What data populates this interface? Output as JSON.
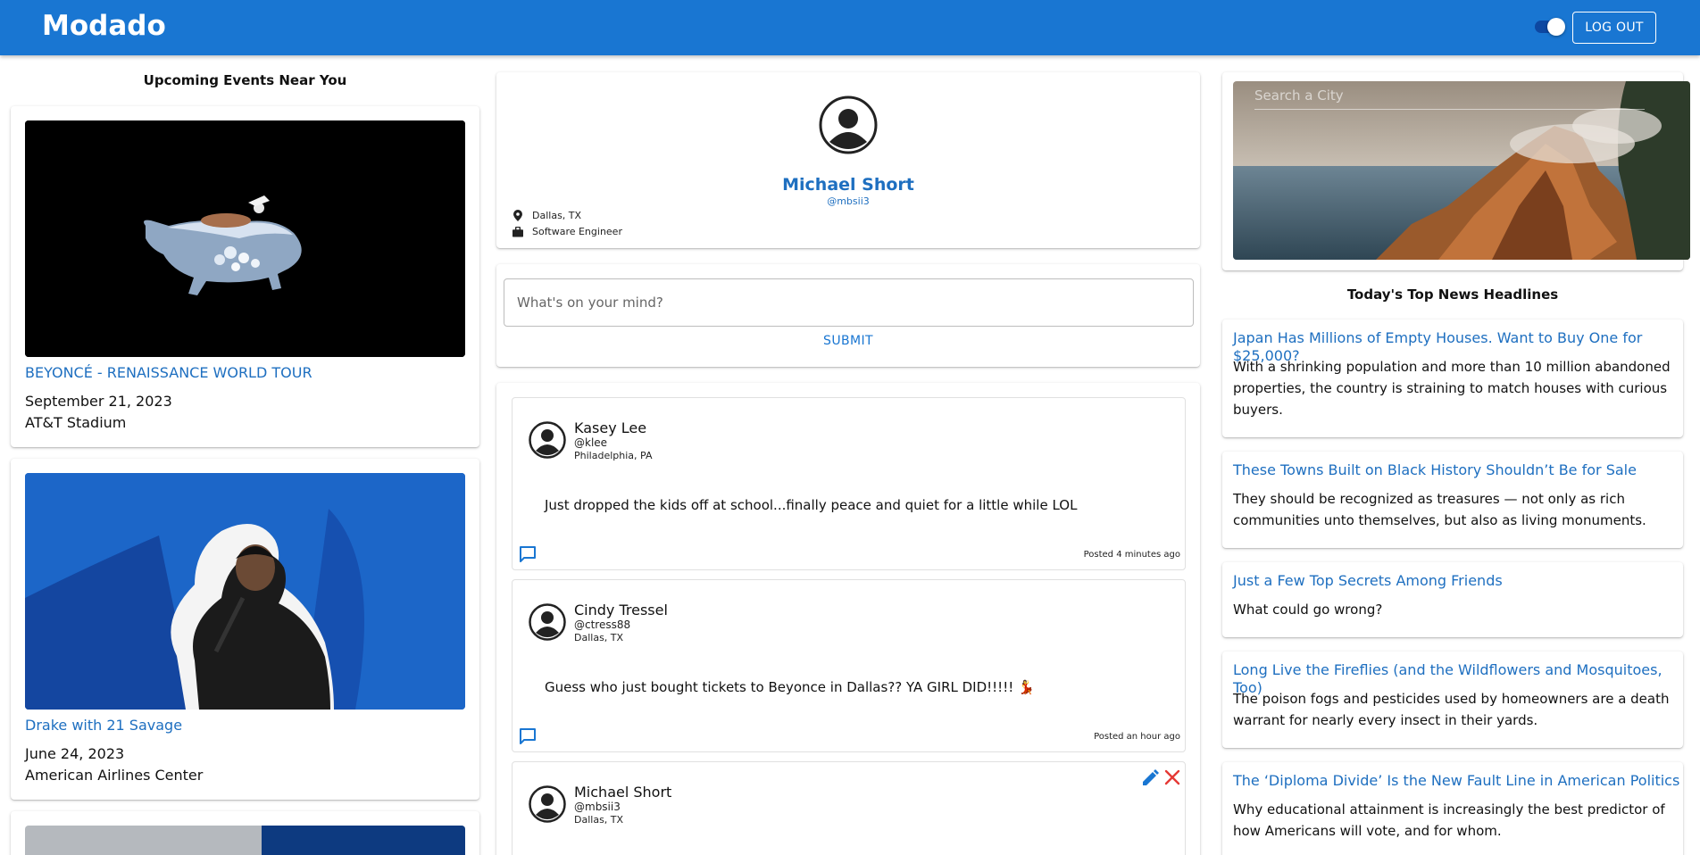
{
  "header": {
    "logo": "Modado",
    "logout_label": "LOG OUT"
  },
  "events": {
    "title": "Upcoming Events Near You",
    "items": [
      {
        "title": "BEYONCÉ - RENAISSANCE WORLD TOUR",
        "date": "September 21, 2023",
        "venue": "AT&T Stadium"
      },
      {
        "title": "Drake with 21 Savage",
        "date": "June 24, 2023",
        "venue": "American Airlines Center"
      }
    ]
  },
  "profile": {
    "name": "Michael Short",
    "handle": "@mbsii3",
    "location": "Dallas, TX",
    "occupation": "Software Engineer"
  },
  "composer": {
    "placeholder": "What's on your mind?",
    "submit_label": "SUBMIT"
  },
  "posts": [
    {
      "name": "Kasey Lee",
      "handle": "@klee",
      "location": "Philadelphia, PA",
      "body": "Just dropped the kids off at school...finally peace and quiet for a little while LOL",
      "time": "Posted 4 minutes ago"
    },
    {
      "name": "Cindy Tressel",
      "handle": "@ctress88",
      "location": "Dallas, TX",
      "body": "Guess who just bought tickets to Beyonce in Dallas?? YA GIRL DID!!!!! 💃",
      "time": "Posted an hour ago"
    },
    {
      "name": "Michael Short",
      "handle": "@mbsii3",
      "location": "Dallas, TX"
    }
  ],
  "weather": {
    "search_placeholder": "Search a City"
  },
  "news": {
    "title": "Today's Top News Headlines",
    "items": [
      {
        "title": "Japan Has Millions of Empty Houses. Want to Buy One for $25,000?",
        "desc": "With a shrinking population and more than 10 million abandoned properties, the country is straining to match houses with curious buyers."
      },
      {
        "title": "These Towns Built on Black History Shouldn’t Be for Sale",
        "desc": "They should be recognized as treasures — not only as rich communities unto themselves, but also as living monuments."
      },
      {
        "title": "Just a Few Top Secrets Among Friends",
        "desc": "What could go wrong?"
      },
      {
        "title": "Long Live the Fireflies (and the Wildflowers and Mosquitoes, Too)",
        "desc": "The poison fogs and pesticides used by homeowners are a death warrant for nearly every insect in their yards."
      },
      {
        "title": "The ‘Diploma Divide’ Is the New Fault Line in American Politics",
        "desc": "Why educational attainment is increasingly the best predictor of how Americans will vote, and for whom."
      }
    ]
  },
  "colors": {
    "primary": "#1976d2",
    "link": "#1e6fc0",
    "delete": "#e53935"
  }
}
